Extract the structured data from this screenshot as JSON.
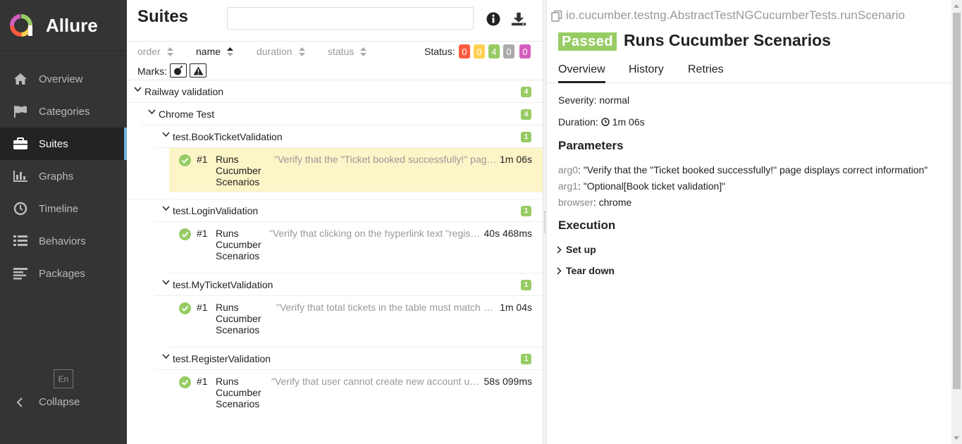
{
  "brand": {
    "name": "Allure"
  },
  "sidebar": {
    "items": [
      {
        "label": "Overview",
        "icon": "home-icon"
      },
      {
        "label": "Categories",
        "icon": "flag-icon"
      },
      {
        "label": "Suites",
        "icon": "briefcase-icon",
        "active": true
      },
      {
        "label": "Graphs",
        "icon": "bar-chart-icon"
      },
      {
        "label": "Timeline",
        "icon": "clock-icon"
      },
      {
        "label": "Behaviors",
        "icon": "list-icon"
      },
      {
        "label": "Packages",
        "icon": "align-left-icon"
      }
    ],
    "language": "En",
    "collapse_label": "Collapse"
  },
  "suites": {
    "title": "Suites",
    "search": {
      "value": "",
      "placeholder": ""
    },
    "sort": {
      "order": "order",
      "name": "name",
      "duration": "duration",
      "status": "status"
    },
    "status_label": "Status:",
    "status_counts": [
      {
        "value": "0",
        "color": "#fd5a3e"
      },
      {
        "value": "0",
        "color": "#ffd050"
      },
      {
        "value": "4",
        "color": "#97cc64"
      },
      {
        "value": "0",
        "color": "#aaaaaa"
      },
      {
        "value": "0",
        "color": "#d35ebe"
      }
    ],
    "marks_label": "Marks:",
    "tree": {
      "root": {
        "name": "Railway validation",
        "count": "4"
      },
      "sub": {
        "name": "Chrome Test",
        "count": "4"
      },
      "classes": [
        {
          "name": "test.BookTicketValidation",
          "count": "1",
          "test": {
            "num": "#1",
            "name": "Runs Cucumber Scenarios",
            "desc": "\"Verify that the \"Ticket booked successfully!\" page displays correct information\"",
            "duration": "1m 06s"
          }
        },
        {
          "name": "test.LoginValidation",
          "count": "1",
          "test": {
            "num": "#1",
            "name": "Runs Cucumber Scenarios",
            "desc": "\"Verify that clicking on the hyperlink text \"registration page\"\"",
            "duration": "40s 468ms"
          }
        },
        {
          "name": "test.MyTicketValidation",
          "count": "1",
          "test": {
            "num": "#1",
            "name": "Runs Cucumber Scenarios",
            "desc": "\"Verify that total tickets in the table must match the number\"",
            "duration": "1m 04s"
          }
        },
        {
          "name": "test.RegisterValidation",
          "count": "1",
          "test": {
            "num": "#1",
            "name": "Runs Cucumber Scenarios",
            "desc": "\"Verify that user cannot create new account using an existing email\"",
            "duration": "58s 099ms"
          }
        }
      ]
    }
  },
  "details": {
    "fqn": "io.cucumber.testng.AbstractTestNGCucumberTests.runScenario",
    "status": "Passed",
    "title": "Runs Cucumber Scenarios",
    "tabs": [
      "Overview",
      "History",
      "Retries"
    ],
    "severity_label": "Severity:",
    "severity": "normal",
    "duration_label": "Duration:",
    "duration": "1m 06s",
    "parameters_title": "Parameters",
    "parameters": [
      {
        "key": "arg0",
        "value": "\"Verify that the \"Ticket booked successfully!\" page displays correct information\""
      },
      {
        "key": "arg1",
        "value": "\"Optional[Book ticket validation]\""
      },
      {
        "key": "browser",
        "value": "chrome"
      }
    ],
    "execution_title": "Execution",
    "steps": [
      "Set up",
      "Tear down"
    ]
  }
}
